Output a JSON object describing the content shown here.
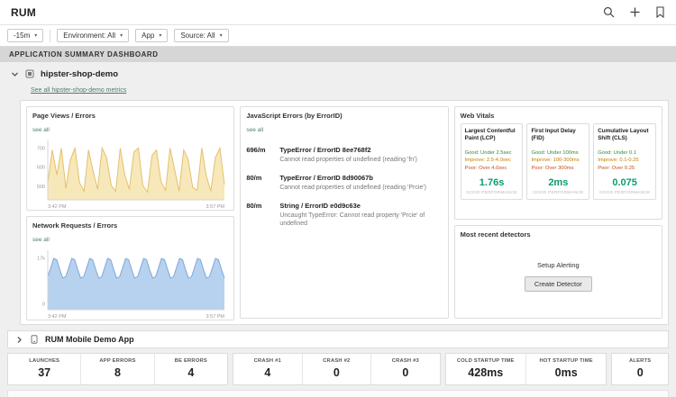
{
  "header": {
    "title": "RUM"
  },
  "filters": {
    "time": "-15m",
    "environment": "Environment: All",
    "app": "App",
    "source": "Source: All"
  },
  "dashboard": {
    "title": "APPLICATION SUMMARY DASHBOARD"
  },
  "section": {
    "name": "hipster-shop-demo",
    "see_all_link": "See all hipster-shop-demo metrics"
  },
  "page_views": {
    "title": "Page Views / Errors",
    "see_all": "see all"
  },
  "network": {
    "title": "Network Requests / Errors",
    "see_all": "see all"
  },
  "js_errors": {
    "title": "JavaScript Errors (by ErrorID)",
    "see_all": "see all",
    "items": [
      {
        "rate": "696/m",
        "name": "TypeError / ErrorID 8ee768f2",
        "detail": "Cannot read properties of undefined (reading 'fn')"
      },
      {
        "rate": "80/m",
        "name": "TypeError / ErrorID 8d90067b",
        "detail": "Cannot read properties of undefined (reading 'Prcie')"
      },
      {
        "rate": "80/m",
        "name": "String / ErrorID e0d9c63e",
        "detail": "Uncaught TypeError: Cannot read property 'Prcie' of undefined"
      }
    ]
  },
  "web_vitals": {
    "title": "Web Vitals",
    "cards": [
      {
        "title": "Largest Contentful Paint (LCP)",
        "good": "Good: Under 2.5sec",
        "improve": "Improve: 2.5-4.0sec",
        "poor": "Poor: Over 4.0sec",
        "value": "1.76s",
        "status": "GOOD PERFORMANCE"
      },
      {
        "title": "First Input Delay (FID)",
        "good": "Good: Under 100ms",
        "improve": "Improve: 100-300ms",
        "poor": "Poor: Over 300ms",
        "value": "2ms",
        "status": "GOOD PERFORMANCE"
      },
      {
        "title": "Cumulative Layout Shift (CLS)",
        "good": "Good: Under 0.1",
        "improve": "Improve: 0.1-0.25",
        "poor": "Poor: Over 0.25",
        "value": "0.075",
        "status": "GOOD PERFORMANCE"
      }
    ]
  },
  "detectors": {
    "title": "Most recent detectors",
    "setup_label": "Setup Alerting",
    "button": "Create Detector"
  },
  "mobile_section": {
    "name": "RUM Mobile Demo App"
  },
  "stats": {
    "groups": [
      {
        "cells": [
          {
            "label": "LAUNCHES",
            "value": "37"
          },
          {
            "label": "APP ERRORS",
            "value": "8"
          },
          {
            "label": "BE ERRORS",
            "value": "4"
          }
        ]
      },
      {
        "cells": [
          {
            "label": "CRASH #1",
            "value": "4"
          },
          {
            "label": "CRASH #2",
            "value": "0"
          },
          {
            "label": "CRASH #3",
            "value": "0"
          }
        ]
      },
      {
        "cells": [
          {
            "label": "COLD STARTUP TIME",
            "value": "428ms"
          },
          {
            "label": "HOT STARTUP TIME",
            "value": "0ms"
          }
        ]
      },
      {
        "cells": [
          {
            "label": "ALERTS",
            "value": "0"
          }
        ]
      }
    ]
  },
  "chart_data": [
    {
      "type": "area",
      "title": "Page Views / Errors",
      "series": [
        {
          "name": "Page Views",
          "values": [
            520,
            690,
            560,
            700,
            490,
            640,
            700,
            520,
            475,
            690,
            580,
            485,
            700,
            650,
            505,
            475,
            700,
            560,
            485,
            680,
            700,
            505,
            470,
            660,
            690,
            525,
            480,
            700,
            590,
            475,
            690,
            640,
            495,
            480,
            700,
            555,
            475,
            650,
            700,
            510
          ]
        }
      ],
      "ylim": [
        430,
        740
      ],
      "x_labels": [
        "3:42 PM",
        "3:57 PM"
      ],
      "ticks": [
        {
          "label": "700",
          "pos": 0.13
        },
        {
          "label": "600",
          "pos": 0.45
        },
        {
          "label": "500",
          "pos": 0.77
        }
      ],
      "fill": "#f7e8ba",
      "stroke": "#e5c06c"
    },
    {
      "type": "area",
      "title": "Network Requests / Errors",
      "series": [
        {
          "name": "Network Requests",
          "values": [
            10800,
            13800,
            16800,
            16400,
            13200,
            10400,
            10800,
            13800,
            16800,
            16400,
            13200,
            10400,
            10800,
            13800,
            16800,
            16400,
            13200,
            10400,
            10800,
            13800,
            16800,
            16400,
            13200,
            10400,
            10800,
            13800,
            16800,
            16400,
            13200,
            10400,
            10800,
            13800,
            16800,
            16400,
            13200,
            10400,
            10800,
            13800,
            16800,
            16400,
            13200,
            10400,
            10800,
            13800,
            16800,
            16400,
            13200,
            10400,
            10800,
            13800,
            16800,
            16400,
            13200,
            10400,
            10800,
            13800,
            16800,
            16400,
            13200,
            10400
          ]
        }
      ],
      "ylim": [
        0,
        19500
      ],
      "x_labels": [
        "3:42 PM",
        "3:57 PM"
      ],
      "ticks": [
        {
          "label": "17k",
          "pos": 0.13
        },
        {
          "label": "0",
          "pos": 0.9
        }
      ],
      "fill": "#b6d2ef",
      "stroke": "#7fa8d8"
    }
  ],
  "colors": {
    "good": "#2e8b3d",
    "improve": "#c07f00",
    "poor": "#c3501c",
    "metric_value": "#0c9b72",
    "status_muted": "#b9b9b9",
    "link": "#4f8067"
  }
}
